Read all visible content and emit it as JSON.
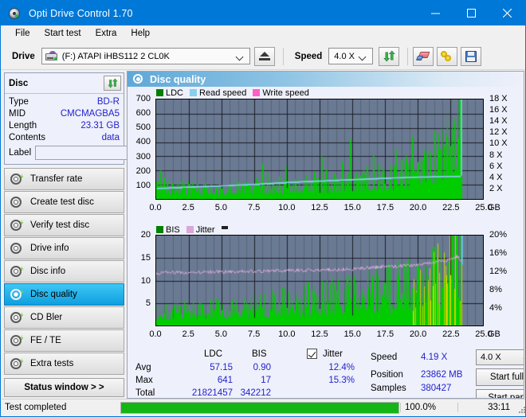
{
  "window": {
    "title": "Opti Drive Control 1.70",
    "icon": "disc-drive-icon",
    "minimize": "minimize-icon",
    "maximize": "maximize-icon",
    "close": "close-icon",
    "accent": "#0078d7"
  },
  "menu": {
    "items": [
      {
        "label": "File"
      },
      {
        "label": "Start test"
      },
      {
        "label": "Extra"
      },
      {
        "label": "Help"
      }
    ]
  },
  "toolbar": {
    "drive_label": "Drive",
    "drive_value": "(F:)  ATAPI iHBS112  2 CL0K",
    "eject_icon": "eject-icon",
    "speed_label": "Speed",
    "speed_value": "4.0 X",
    "refresh_icon": "refresh-icon",
    "erase_icon": "erase-icon",
    "tools_icon": "tools-icon",
    "save_icon": "save-icon"
  },
  "disc": {
    "header": "Disc",
    "refresh_icon": "refresh-icon",
    "rows": [
      {
        "key": "Type",
        "value": "BD-R"
      },
      {
        "key": "MID",
        "value": "CMCMAGBA5"
      },
      {
        "key": "Length",
        "value": "23.31 GB"
      },
      {
        "key": "Contents",
        "value": "data"
      }
    ],
    "label_key": "Label",
    "label_value": "",
    "label_placeholder": "",
    "label_button_icon": "disc-icon"
  },
  "sidebar": {
    "items": [
      {
        "label": "Transfer rate",
        "icon": "disc-test-icon",
        "selected": false
      },
      {
        "label": "Create test disc",
        "icon": "disc-test-icon",
        "selected": false
      },
      {
        "label": "Verify test disc",
        "icon": "disc-test-icon",
        "selected": false
      },
      {
        "label": "Drive info",
        "icon": "disc-info-icon",
        "selected": false
      },
      {
        "label": "Disc info",
        "icon": "disc-info-icon",
        "selected": false
      },
      {
        "label": "Disc quality",
        "icon": "disc-quality-icon",
        "selected": true
      },
      {
        "label": "CD Bler",
        "icon": "disc-test-icon",
        "selected": false
      },
      {
        "label": "FE / TE",
        "icon": "disc-test-icon",
        "selected": false
      },
      {
        "label": "Extra tests",
        "icon": "disc-test-icon",
        "selected": false
      }
    ],
    "status_button": "Status window > >"
  },
  "panel": {
    "title": "Disc quality",
    "icon": "disc-quality-icon"
  },
  "chart_data": [
    {
      "type": "area",
      "id": "ldc-chart",
      "title": "",
      "legend": [
        {
          "name": "LDC",
          "color": "#008000"
        },
        {
          "name": "Read speed",
          "color": "#87cfef"
        },
        {
          "name": "Write speed",
          "color": "#ff5ecb"
        }
      ],
      "legend_position": "top-left",
      "grid": true,
      "xlabel": "GB",
      "xlim": [
        0.0,
        25.0
      ],
      "xticks": [
        "0.0",
        "2.5",
        "5.0",
        "7.5",
        "10.0",
        "12.5",
        "15.0",
        "17.5",
        "20.0",
        "22.5",
        "25.0"
      ],
      "ylabel": "",
      "ylim": [
        0,
        700
      ],
      "yticks": [
        "700",
        "600",
        "500",
        "400",
        "300",
        "200",
        "100"
      ],
      "y2label": "",
      "y2lim": [
        0,
        18
      ],
      "y2ticks": [
        "18 X",
        "16 X",
        "14 X",
        "12 X",
        "10 X",
        "8 X",
        "6 X",
        "4 X",
        "2 X"
      ],
      "data_end_gb": 23.4,
      "series": [
        {
          "name": "LDC",
          "color": "#00cc00",
          "style": "filled-spikes",
          "baseline": [
            45,
            40,
            38,
            36,
            35,
            34,
            34,
            33,
            33,
            34,
            34,
            35,
            35,
            36,
            36,
            37,
            37,
            38,
            38,
            39,
            40,
            41,
            42,
            43,
            44,
            45,
            46,
            47,
            48,
            50,
            52,
            54,
            56,
            58,
            60,
            63,
            66,
            70,
            74,
            78,
            84,
            90,
            98,
            108,
            120,
            135,
            155,
            180,
            215,
            260
          ],
          "spikes": [
            {
              "x": 0.3,
              "y": 200
            },
            {
              "x": 0.6,
              "y": 150
            },
            {
              "x": 1.2,
              "y": 110
            },
            {
              "x": 2.0,
              "y": 130
            },
            {
              "x": 2.4,
              "y": 125
            },
            {
              "x": 3.1,
              "y": 105
            },
            {
              "x": 3.7,
              "y": 115
            },
            {
              "x": 4.6,
              "y": 95
            },
            {
              "x": 5.6,
              "y": 100
            },
            {
              "x": 6.8,
              "y": 120
            },
            {
              "x": 7.6,
              "y": 145
            },
            {
              "x": 8.1,
              "y": 250
            },
            {
              "x": 8.5,
              "y": 175
            },
            {
              "x": 9.4,
              "y": 160
            },
            {
              "x": 9.9,
              "y": 230
            },
            {
              "x": 10.6,
              "y": 140
            },
            {
              "x": 11.4,
              "y": 165
            },
            {
              "x": 12.1,
              "y": 190
            },
            {
              "x": 12.6,
              "y": 300
            },
            {
              "x": 13.0,
              "y": 210
            },
            {
              "x": 13.6,
              "y": 175
            },
            {
              "x": 14.2,
              "y": 260
            },
            {
              "x": 14.8,
              "y": 420
            },
            {
              "x": 15.3,
              "y": 185
            },
            {
              "x": 16.1,
              "y": 230
            },
            {
              "x": 16.6,
              "y": 310
            },
            {
              "x": 17.0,
              "y": 250
            },
            {
              "x": 17.4,
              "y": 200
            },
            {
              "x": 17.9,
              "y": 240
            },
            {
              "x": 18.3,
              "y": 350
            },
            {
              "x": 18.7,
              "y": 265
            },
            {
              "x": 19.1,
              "y": 300
            },
            {
              "x": 19.6,
              "y": 440
            },
            {
              "x": 20.0,
              "y": 260
            },
            {
              "x": 20.4,
              "y": 290
            },
            {
              "x": 20.9,
              "y": 330
            },
            {
              "x": 21.3,
              "y": 480
            },
            {
              "x": 21.7,
              "y": 350
            },
            {
              "x": 22.0,
              "y": 380
            },
            {
              "x": 22.4,
              "y": 420
            },
            {
              "x": 22.8,
              "y": 560
            },
            {
              "x": 23.1,
              "y": 430
            },
            {
              "x": 23.3,
              "y": 700
            }
          ]
        },
        {
          "name": "Read speed",
          "color": "#87cfef",
          "style": "step-line",
          "axis": "right",
          "points": [
            [
              0.05,
              1.9
            ],
            [
              1.0,
              2.0
            ],
            [
              2.0,
              2.1
            ],
            [
              3.0,
              2.2
            ],
            [
              4.0,
              2.3
            ],
            [
              5.0,
              2.4
            ],
            [
              6.0,
              2.5
            ],
            [
              7.0,
              2.6
            ],
            [
              8.0,
              2.7
            ],
            [
              9.0,
              2.85
            ],
            [
              10.0,
              3.0
            ],
            [
              11.0,
              3.1
            ],
            [
              12.0,
              3.2
            ],
            [
              13.0,
              3.3
            ],
            [
              14.0,
              3.4
            ],
            [
              15.0,
              3.5
            ],
            [
              16.0,
              3.6
            ],
            [
              17.0,
              3.7
            ],
            [
              18.0,
              3.8
            ],
            [
              19.0,
              3.9
            ],
            [
              20.0,
              3.95
            ],
            [
              21.0,
              4.0
            ],
            [
              22.0,
              4.05
            ],
            [
              23.3,
              4.1
            ]
          ],
          "end_spike": {
            "x": 23.35,
            "y": 18.0
          }
        }
      ]
    },
    {
      "type": "area",
      "id": "bis-jitter-chart",
      "title": "",
      "legend": [
        {
          "name": "BIS",
          "color": "#008000"
        },
        {
          "name": "Jitter",
          "color": "#d8a8d8"
        }
      ],
      "legend_position": "top-left",
      "grid": true,
      "xlabel": "GB",
      "xlim": [
        0.0,
        25.0
      ],
      "xticks": [
        "0.0",
        "2.5",
        "5.0",
        "7.5",
        "10.0",
        "12.5",
        "15.0",
        "17.5",
        "20.0",
        "22.5",
        "25.0"
      ],
      "ylim": [
        0,
        20
      ],
      "yticks": [
        "20",
        "15",
        "10",
        "5"
      ],
      "y2lim": [
        0,
        20
      ],
      "y2ticks": [
        "20%",
        "16%",
        "12%",
        "8%",
        "4%"
      ],
      "data_end_gb": 23.4,
      "series": [
        {
          "name": "BIS",
          "color": "#00cc00",
          "style": "filled-spikes",
          "baseline": [
            1.6,
            1.7,
            1.7,
            1.8,
            1.8,
            1.9,
            1.9,
            2.0,
            2.0,
            2.1,
            2.1,
            2.2,
            2.2,
            2.3,
            2.4,
            2.4,
            2.5,
            2.6,
            2.6,
            2.7,
            2.8,
            2.9,
            3.0,
            3.1,
            3.2,
            3.3,
            3.4,
            3.5,
            3.6,
            3.7,
            3.8,
            3.9,
            4.0,
            4.1,
            4.2,
            4.3,
            4.4,
            4.5,
            4.6,
            4.8,
            4.9,
            5.1,
            5.3,
            5.6,
            5.9,
            6.3,
            6.9,
            7.6,
            8.6,
            10.2
          ],
          "high_color": "#c8d400",
          "high_region_start_gb": 19.5
        },
        {
          "name": "Jitter",
          "color": "#d8a8d8",
          "style": "line",
          "axis": "right",
          "points": [
            [
              0.1,
              11.6
            ],
            [
              1.0,
              11.8
            ],
            [
              2.0,
              11.8
            ],
            [
              3.0,
              11.8
            ],
            [
              4.0,
              11.9
            ],
            [
              5.0,
              11.9
            ],
            [
              6.0,
              12.0
            ],
            [
              7.0,
              12.1
            ],
            [
              8.0,
              12.1
            ],
            [
              9.0,
              12.2
            ],
            [
              10.0,
              12.2
            ],
            [
              11.0,
              12.3
            ],
            [
              12.0,
              12.3
            ],
            [
              13.0,
              12.4
            ],
            [
              14.0,
              12.4
            ],
            [
              15.0,
              12.6
            ],
            [
              16.0,
              12.8
            ],
            [
              17.0,
              13.0
            ],
            [
              18.0,
              13.1
            ],
            [
              19.0,
              13.3
            ],
            [
              20.0,
              13.5
            ],
            [
              21.0,
              13.9
            ],
            [
              22.0,
              14.4
            ],
            [
              23.0,
              15.3
            ],
            [
              23.35,
              14.6
            ]
          ],
          "end_spike": {
            "x": 23.4,
            "y": 20.0,
            "color": "#6fd6f5"
          }
        }
      ]
    }
  ],
  "stats": {
    "col_headers": [
      "LDC",
      "BIS"
    ],
    "rows": [
      {
        "label": "Avg",
        "ldc": "57.15",
        "bis": "0.90",
        "jitter": "12.4%"
      },
      {
        "label": "Max",
        "ldc": "641",
        "bis": "17",
        "jitter": "15.3%"
      },
      {
        "label": "Total",
        "ldc": "21821457",
        "bis": "342212",
        "jitter": ""
      }
    ],
    "jitter_label": "Jitter",
    "jitter_checked": true,
    "speed_label": "Speed",
    "speed_value": "4.19 X",
    "position_label": "Position",
    "position_value": "23862 MB",
    "samples_label": "Samples",
    "samples_value": "380427",
    "speed_select": "4.0 X",
    "start_full": "Start full",
    "start_part": "Start part"
  },
  "statusbar": {
    "text": "Test completed",
    "percent_label": "100.0%",
    "percent": 100,
    "time": "33:11",
    "bar_color": "#14b514"
  }
}
